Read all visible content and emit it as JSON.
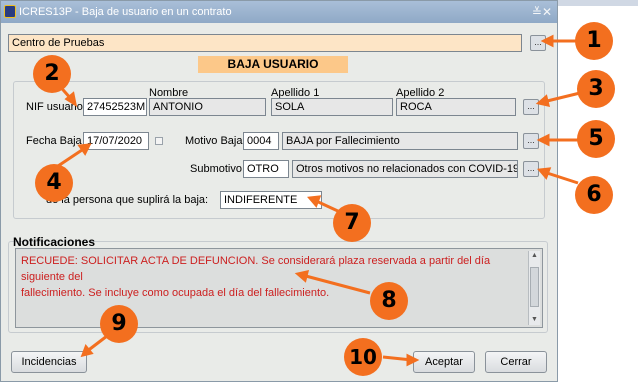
{
  "window": {
    "title": "ICRES13P - Baja de usuario en un contrato",
    "controls": "≚✕"
  },
  "center": {
    "value": "Centro de Pruebas"
  },
  "banner": "BAJA USUARIO",
  "headers": {
    "nombre": "Nombre",
    "apellido1": "Apellido 1",
    "apellido2": "Apellido 2"
  },
  "nif": {
    "label": "NIF usuario",
    "value": "27452523M",
    "nombre": "ANTONIO",
    "apellido1": "SOLA",
    "apellido2": "ROCA"
  },
  "fecha": {
    "label": "Fecha Baja",
    "value": "17/07/2020"
  },
  "motivo": {
    "label": "Motivo Baja",
    "code": "0004",
    "description": "BAJA por Fallecimiento"
  },
  "submotivo": {
    "label": "Submotivo",
    "code": "OTRO",
    "description": "Otros motivos no relacionados con COVID-19"
  },
  "suplente": {
    "label": "de la persona que suplirá la baja:",
    "value": "INDIFERENTE"
  },
  "notificaciones": {
    "title": "Notificaciones",
    "line1": "RECUEDE: SOLICITAR ACTA DE DEFUNCION. Se considerará plaza reservada a partir del día siguiente del",
    "line2": "fallecimiento. Se incluye como ocupada el día del fallecimiento."
  },
  "buttons": {
    "incidencias": "Incidencias",
    "aceptar": "Aceptar",
    "cerrar": "Cerrar",
    "ellipsis": "..."
  },
  "callouts": [
    "1",
    "2",
    "3",
    "4",
    "5",
    "6",
    "7",
    "8",
    "9",
    "10"
  ],
  "colors": {
    "callout": "#f36f1f",
    "banner": "#fcc889",
    "notif_text": "#cc2020",
    "title_bar": "#9db5d0"
  }
}
